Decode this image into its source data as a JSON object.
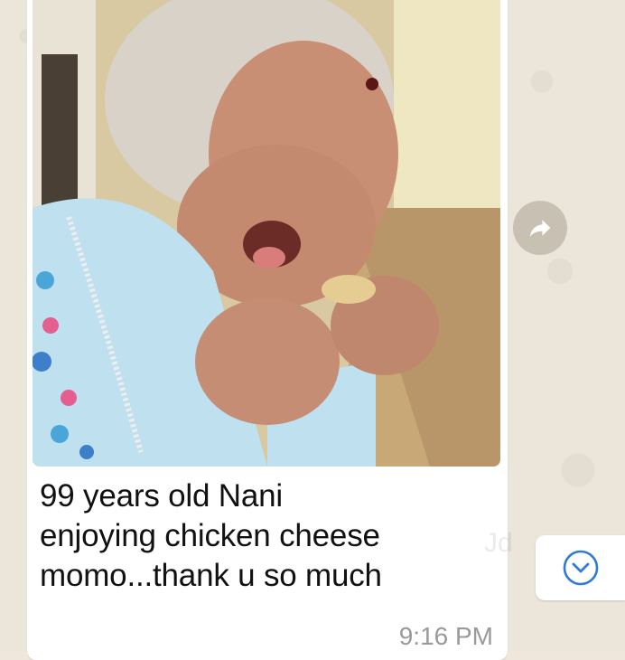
{
  "message": {
    "caption_lines": [
      "99 years old Nani",
      "enjoying chicken cheese",
      "momo...thank u so much"
    ],
    "time": "9:16 PM",
    "photo_icon": "photo-of-elderly-woman-eating"
  },
  "buttons": {
    "forward_icon": "share-forward-icon",
    "scroll_icon": "chevron-down-circle-icon"
  },
  "watermark_text": "Jd",
  "colors": {
    "bubble": "#ffffff",
    "wallpaper": "#ece5da",
    "accent": "#2f7bd6"
  }
}
